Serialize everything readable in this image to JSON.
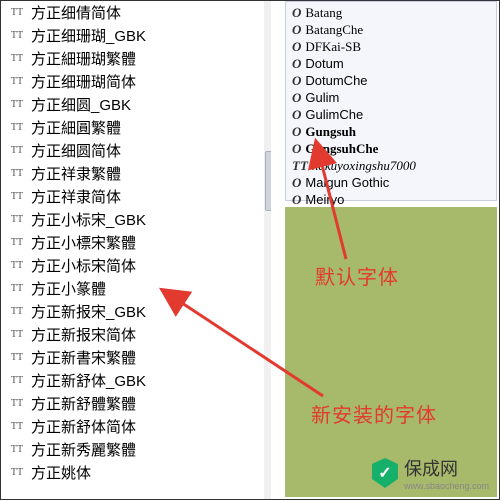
{
  "left_fonts": [
    {
      "icon": "TT",
      "name": "方正细倩简体"
    },
    {
      "icon": "TT",
      "name": "方正细珊瑚_GBK"
    },
    {
      "icon": "TT",
      "name": "方正細珊瑚繁體"
    },
    {
      "icon": "TT",
      "name": "方正细珊瑚简体"
    },
    {
      "icon": "TT",
      "name": "方正细圆_GBK"
    },
    {
      "icon": "TT",
      "name": "方正細圓繁體"
    },
    {
      "icon": "TT",
      "name": "方正细圆简体"
    },
    {
      "icon": "TT",
      "name": "方正祥隶繁體"
    },
    {
      "icon": "TT",
      "name": "方正祥隶简体"
    },
    {
      "icon": "TT",
      "name": "方正小标宋_GBK"
    },
    {
      "icon": "TT",
      "name": "方正小標宋繁體"
    },
    {
      "icon": "TT",
      "name": "方正小标宋简体"
    },
    {
      "icon": "TT",
      "name": "方正小篆體"
    },
    {
      "icon": "TT",
      "name": "方正新报宋_GBK"
    },
    {
      "icon": "TT",
      "name": "方正新报宋简体"
    },
    {
      "icon": "TT",
      "name": "方正新書宋繁體"
    },
    {
      "icon": "TT",
      "name": "方正新舒体_GBK"
    },
    {
      "icon": "TT",
      "name": "方正新舒體繁體"
    },
    {
      "icon": "TT",
      "name": "方正新舒体简体"
    },
    {
      "icon": "TT",
      "name": "方正新秀麗繁體"
    },
    {
      "icon": "TT",
      "name": "方正姚体"
    }
  ],
  "right_fonts": [
    {
      "icon": "O",
      "name": "Batang",
      "cls": "serif"
    },
    {
      "icon": "O",
      "name": "BatangChe",
      "cls": "serif"
    },
    {
      "icon": "O",
      "name": "DFKai-SB",
      "cls": "serif"
    },
    {
      "icon": "O",
      "name": "Dotum",
      "cls": ""
    },
    {
      "icon": "O",
      "name": "DotumChe",
      "cls": ""
    },
    {
      "icon": "O",
      "name": "Gulim",
      "cls": ""
    },
    {
      "icon": "O",
      "name": "GulimChe",
      "cls": ""
    },
    {
      "icon": "O",
      "name": "Gungsuh",
      "cls": "serif bold"
    },
    {
      "icon": "O",
      "name": "GungsuhChe",
      "cls": "serif bold"
    },
    {
      "icon": "TT",
      "name": "hakuyoxingshu7000",
      "cls": "script"
    },
    {
      "icon": "O",
      "name": "Malgun Gothic",
      "cls": ""
    },
    {
      "icon": "O",
      "name": "Meiryo",
      "cls": ""
    }
  ],
  "annotations": {
    "default_font": "默认字体",
    "new_installed_font": "新安装的字体"
  },
  "watermark": {
    "text": "保成网",
    "domain": "www.sbaocheng.com"
  },
  "colors": {
    "arrow": "#e33a2f",
    "green_panel": "#a7b96a",
    "right_panel_bg": "#f4f6fb",
    "logo": "#17b06a"
  }
}
